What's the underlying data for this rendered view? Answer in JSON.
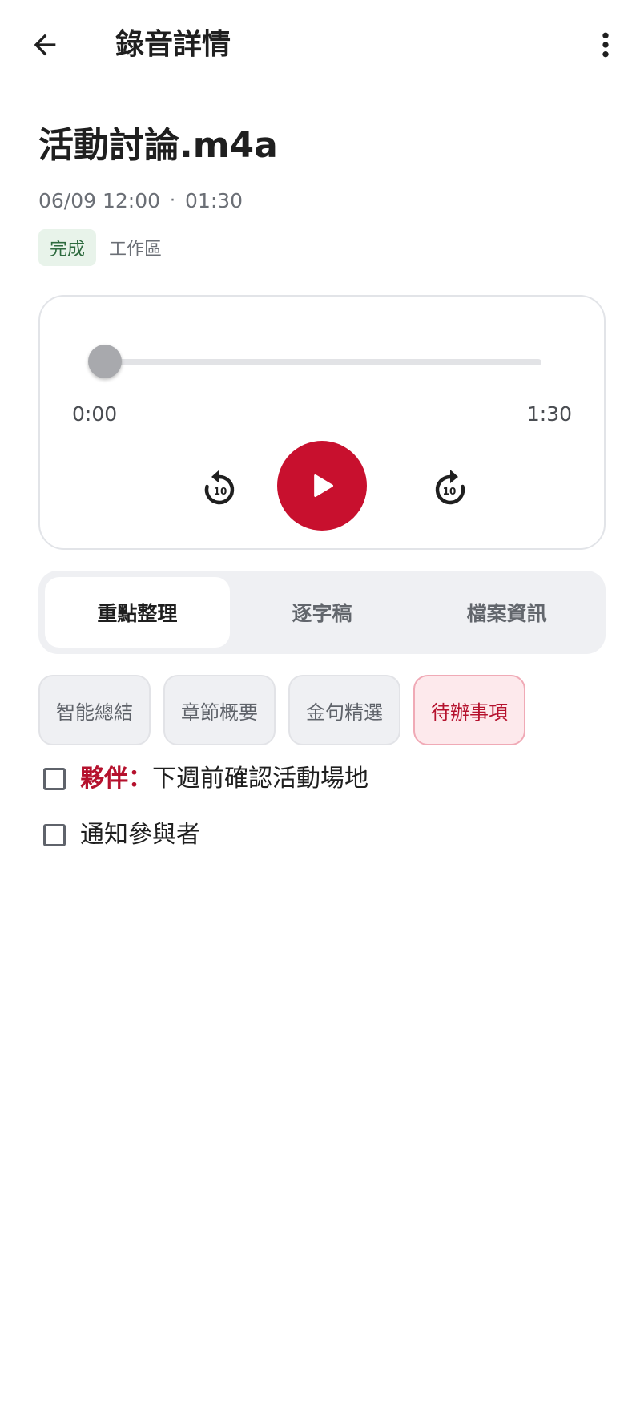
{
  "appbar": {
    "title": "錄音詳情"
  },
  "recording": {
    "file_name": "活動討論.m4a",
    "date_time": "06/09 12:00",
    "separator": "·",
    "duration": "01:30",
    "status": "完成",
    "workspace": "工作區"
  },
  "player": {
    "current_time": "0:00",
    "total_time": "1:30",
    "progress": 0,
    "skip_seconds": "10",
    "accent_color": "#c8102e"
  },
  "tabs": [
    {
      "label": "重點整理",
      "active": true
    },
    {
      "label": "逐字稿",
      "active": false
    },
    {
      "label": "檔案資訊",
      "active": false
    }
  ],
  "chips": [
    {
      "label": "智能總結",
      "active": false
    },
    {
      "label": "章節概要",
      "active": false
    },
    {
      "label": "金句精選",
      "active": false
    },
    {
      "label": "待辦事項",
      "active": true
    }
  ],
  "todos": [
    {
      "owner": "夥伴：",
      "text": "下週前確認活動場地",
      "checked": false
    },
    {
      "owner": "",
      "text": "通知參與者",
      "checked": false
    }
  ],
  "icons": {
    "back": "arrow-left-icon",
    "more": "more-vert-icon",
    "rewind": "replay-10-icon",
    "play": "play-icon",
    "forward": "forward-10-icon"
  }
}
